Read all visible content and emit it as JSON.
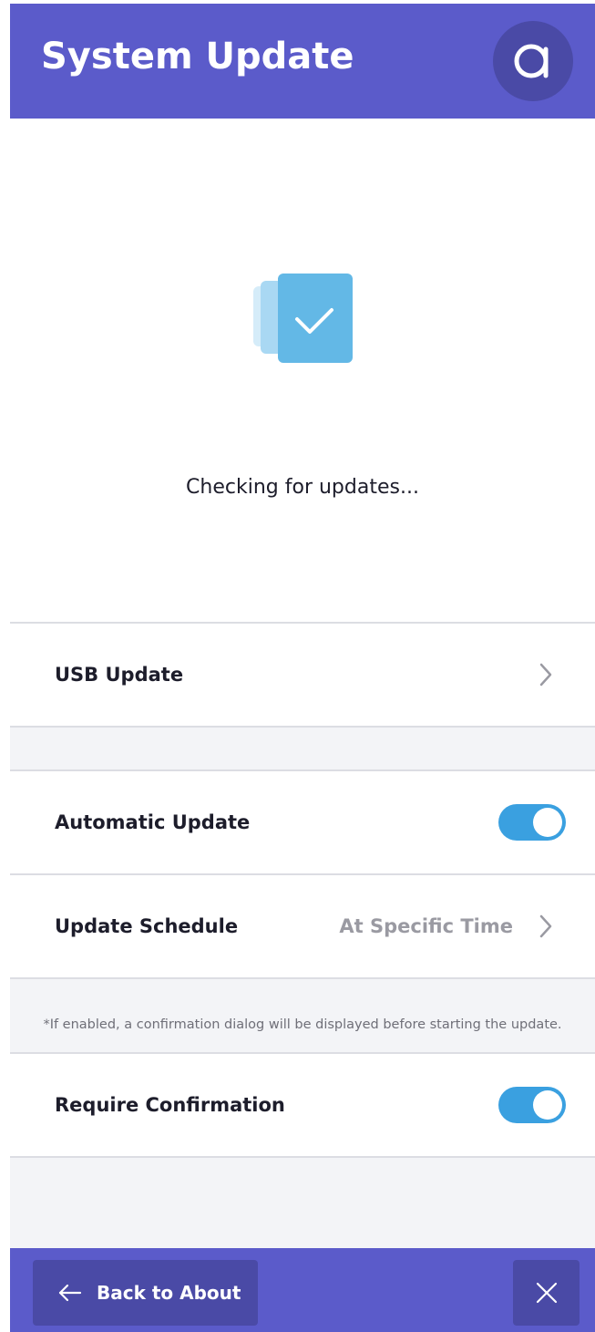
{
  "header": {
    "title": "System Update",
    "avatar_icon": "brand-logo-icon"
  },
  "status": {
    "icon": "update-check-icon",
    "message": "Checking for updates..."
  },
  "settings": {
    "usb_update": {
      "label": "USB Update",
      "icon": "chevron-right-icon"
    },
    "automatic_update": {
      "label": "Automatic Update",
      "enabled": true
    },
    "update_schedule": {
      "label": "Update Schedule",
      "value": "At Specific Time",
      "icon": "chevron-right-icon"
    },
    "confirmation_note": "*If enabled, a confirmation dialog will be displayed before starting the update.",
    "require_confirmation": {
      "label": "Require Confirmation",
      "enabled": true
    }
  },
  "footer": {
    "back_label": "Back to About",
    "back_icon": "arrow-left-icon",
    "close_icon": "close-icon"
  },
  "colors": {
    "brand": "#5b5bca",
    "brand_dark": "#4a4aa6",
    "toggle_on": "#3aa0e0",
    "icon_blue": "#63b8e6"
  }
}
